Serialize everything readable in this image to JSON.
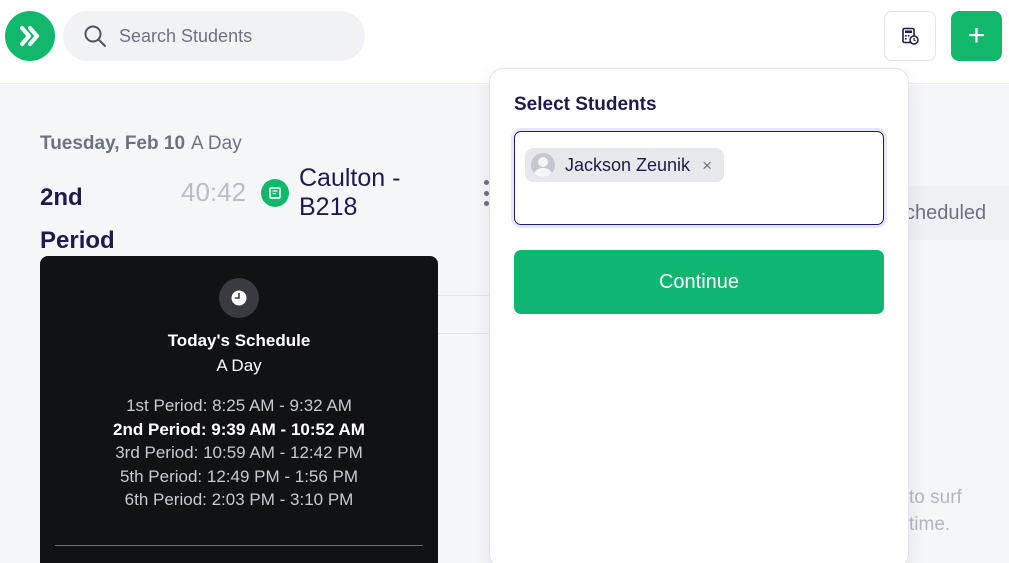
{
  "header": {
    "logo_icon": "double-chevron-right-icon",
    "search_placeholder": "Search Students",
    "calculator_icon": "calculator-clock-icon",
    "add_label": "+",
    "accent_color": "#11b76b"
  },
  "period": {
    "date": "Tuesday, Feb 10",
    "day_type": "A Day",
    "name": "2nd Period",
    "timer": "40:42",
    "room": "Caulton - B218"
  },
  "background": {
    "tab_partial": "cheduled",
    "hint_line1": "to surf",
    "hint_line2": "time."
  },
  "schedule": {
    "title": "Today's Schedule",
    "subtitle": "A Day",
    "items": [
      {
        "label": "1st Period: 8:25 AM - 9:32 AM",
        "current": false
      },
      {
        "label": "2nd Period: 9:39 AM - 10:52 AM",
        "current": true
      },
      {
        "label": "3rd Period: 10:59 AM - 12:42 PM",
        "current": false
      },
      {
        "label": "5th Period: 12:49 PM - 1:56 PM",
        "current": false
      },
      {
        "label": "6th Period: 2:03 PM - 3:10 PM",
        "current": false
      }
    ]
  },
  "popover": {
    "title": "Select Students",
    "selected": [
      {
        "name": "Jackson Zeunik",
        "remove": "×"
      }
    ],
    "continue_label": "Continue"
  }
}
